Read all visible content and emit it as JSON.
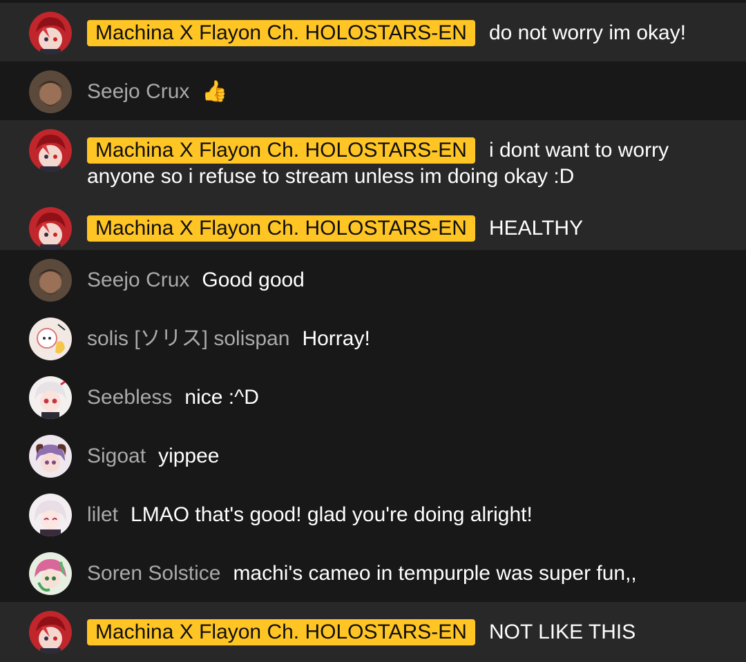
{
  "messages": [
    {
      "author": "Machina X Flayon Ch. HOLOSTARS-EN",
      "text": "do not worry im okay!",
      "owner": true,
      "avatar": "machina-avatar"
    },
    {
      "author": "Seejo Crux",
      "text": "👍",
      "owner": false,
      "avatar": "seejo-avatar"
    },
    {
      "author": "Machina X Flayon Ch. HOLOSTARS-EN",
      "text": "i dont want to worry anyone so i refuse to stream unless im doing okay :D",
      "owner": true,
      "avatar": "machina-avatar"
    },
    {
      "author": "Machina X Flayon Ch. HOLOSTARS-EN",
      "text": "HEALTHY",
      "owner": true,
      "avatar": "machina-avatar"
    },
    {
      "author": "Seejo Crux",
      "text": "Good good",
      "owner": false,
      "avatar": "seejo-avatar"
    },
    {
      "author": "solis [ソリス] solispan",
      "text": "Horray!",
      "owner": false,
      "avatar": "solis-avatar"
    },
    {
      "author": "Seebless",
      "text": "nice :^D",
      "owner": false,
      "avatar": "seebless-avatar"
    },
    {
      "author": "Sigoat",
      "text": "yippee",
      "owner": false,
      "avatar": "sigoat-avatar"
    },
    {
      "author": "lilet",
      "text": "LMAO that's good! glad you're doing alright!",
      "owner": false,
      "avatar": "lilet-avatar"
    },
    {
      "author": "Soren Solstice",
      "text": "machi's cameo in tempurple was super fun,,",
      "owner": false,
      "avatar": "soren-avatar"
    },
    {
      "author": "Machina X Flayon Ch. HOLOSTARS-EN",
      "text": "NOT LIKE THIS",
      "owner": true,
      "avatar": "machina-avatar"
    }
  ],
  "colors": {
    "background": "#181818",
    "owner_row": "#282828",
    "owner_badge": "#ffc524",
    "author_name": "#aaaaaa",
    "message_text": "#ffffff"
  }
}
